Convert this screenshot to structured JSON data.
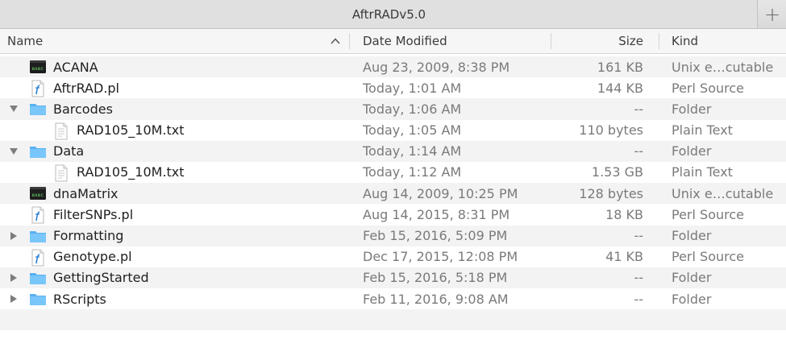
{
  "window": {
    "title": "AftrRADv5.0",
    "add_tab_label": "+"
  },
  "columns": {
    "name": "Name",
    "date": "Date Modified",
    "size": "Size",
    "kind": "Kind"
  },
  "files": [
    {
      "name": "ACANA",
      "date": "Aug 23, 2009, 8:38 PM",
      "size": "161 KB",
      "kind": "Unix e…cutable",
      "icon": "terminal-exec-icon",
      "depth": 0,
      "disclosure": "none"
    },
    {
      "name": "AftrRAD.pl",
      "date": "Today, 1:01 AM",
      "size": "144 KB",
      "kind": "Perl Source",
      "icon": "perl-file-icon",
      "depth": 0,
      "disclosure": "none"
    },
    {
      "name": "Barcodes",
      "date": "Today, 1:06 AM",
      "size": "--",
      "kind": "Folder",
      "icon": "folder-icon",
      "depth": 0,
      "disclosure": "expanded"
    },
    {
      "name": "RAD105_10M.txt",
      "date": "Today, 1:05 AM",
      "size": "110 bytes",
      "kind": "Plain Text",
      "icon": "text-file-icon",
      "depth": 1,
      "disclosure": "none"
    },
    {
      "name": "Data",
      "date": "Today, 1:14 AM",
      "size": "--",
      "kind": "Folder",
      "icon": "folder-icon",
      "depth": 0,
      "disclosure": "expanded"
    },
    {
      "name": "RAD105_10M.txt",
      "date": "Today, 1:12 AM",
      "size": "1.53 GB",
      "kind": "Plain Text",
      "icon": "text-file-icon",
      "depth": 1,
      "disclosure": "none"
    },
    {
      "name": "dnaMatrix",
      "date": "Aug 14, 2009, 10:25 PM",
      "size": "128 bytes",
      "kind": "Unix e…cutable",
      "icon": "terminal-exec-icon",
      "depth": 0,
      "disclosure": "none"
    },
    {
      "name": "FilterSNPs.pl",
      "date": "Aug 14, 2015, 8:31 PM",
      "size": "18 KB",
      "kind": "Perl Source",
      "icon": "perl-file-icon",
      "depth": 0,
      "disclosure": "none"
    },
    {
      "name": "Formatting",
      "date": "Feb 15, 2016, 5:09 PM",
      "size": "--",
      "kind": "Folder",
      "icon": "folder-icon",
      "depth": 0,
      "disclosure": "collapsed"
    },
    {
      "name": "Genotype.pl",
      "date": "Dec 17, 2015, 12:08 PM",
      "size": "41 KB",
      "kind": "Perl Source",
      "icon": "perl-file-icon",
      "depth": 0,
      "disclosure": "none"
    },
    {
      "name": "GettingStarted",
      "date": "Feb 15, 2016, 5:18 PM",
      "size": "--",
      "kind": "Folder",
      "icon": "folder-icon",
      "depth": 0,
      "disclosure": "collapsed"
    },
    {
      "name": "RScripts",
      "date": "Feb 11, 2016, 9:08 AM",
      "size": "--",
      "kind": "Folder",
      "icon": "folder-icon",
      "depth": 0,
      "disclosure": "collapsed"
    }
  ]
}
